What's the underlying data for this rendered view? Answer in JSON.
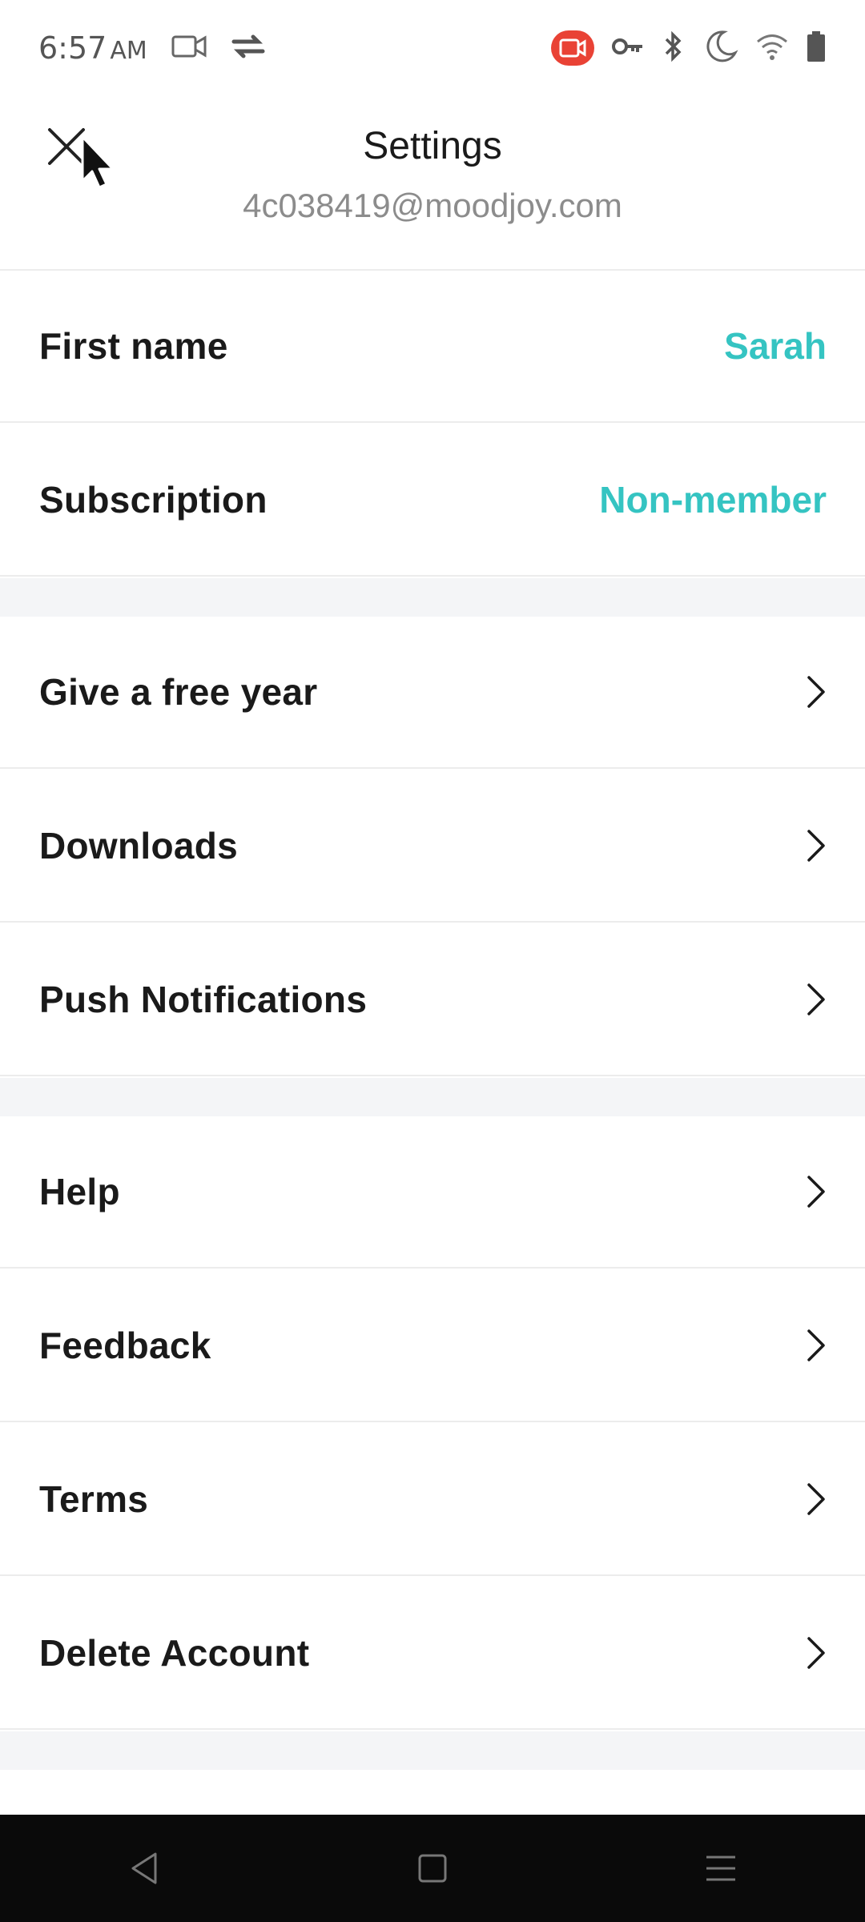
{
  "status_bar": {
    "time": "6:57",
    "ampm": "AM",
    "icons": [
      "video-camera-icon",
      "sync-icon",
      "screen-record-icon",
      "vpn-key-icon",
      "bluetooth-icon",
      "do-not-disturb-moon-icon",
      "wifi-icon",
      "battery-icon"
    ],
    "record_color": "#e94235"
  },
  "header": {
    "title": "Settings",
    "email": "4c038419@moodjoy.com",
    "close_icon": "close-icon"
  },
  "profile": [
    {
      "label": "First name",
      "value": "Sarah"
    },
    {
      "label": "Subscription",
      "value": "Non-member"
    }
  ],
  "section_one": [
    {
      "label": "Give a free year"
    },
    {
      "label": "Downloads"
    },
    {
      "label": "Push Notifications"
    }
  ],
  "section_two": [
    {
      "label": "Help"
    },
    {
      "label": "Feedback"
    },
    {
      "label": "Terms"
    },
    {
      "label": "Delete Account"
    }
  ],
  "colors": {
    "accent": "#35c4c2",
    "section_gap": "#f4f5f7",
    "nav_bar": "#0a0a0a"
  },
  "nav_bar": {
    "buttons": [
      "back-icon",
      "home-icon",
      "recents-icon"
    ]
  }
}
